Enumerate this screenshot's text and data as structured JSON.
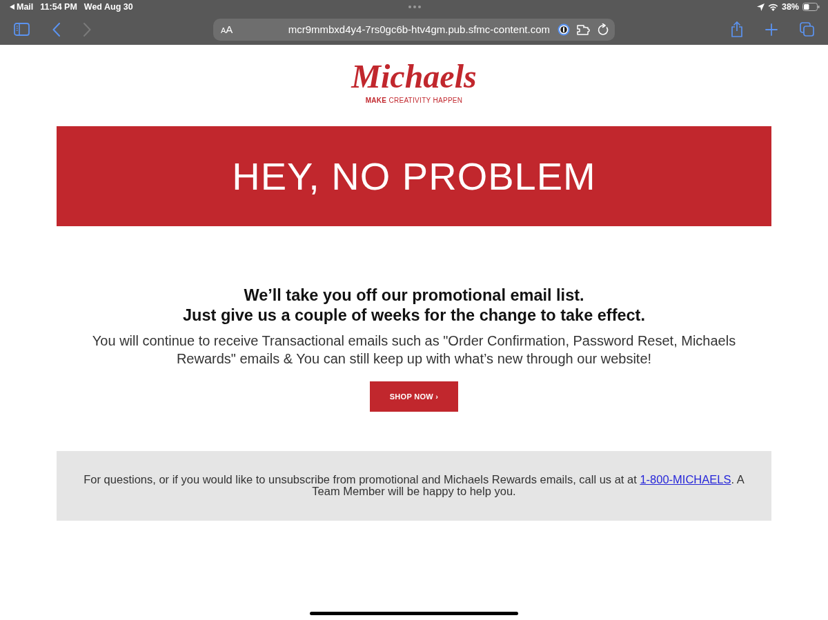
{
  "status_bar": {
    "back_app": "Mail",
    "time": "11:54 PM",
    "date": "Wed Aug 30",
    "battery": "38%"
  },
  "toolbar": {
    "nav": [
      {
        "kind": "back",
        "disabled": false
      },
      {
        "kind": "forward",
        "disabled": true
      }
    ],
    "address_bar": {
      "text_size": "AA",
      "url": "mcr9mmbxd4y4-7rs0gc6b-htv4gm.pub.sfmc-content.com"
    }
  },
  "logo": {
    "wordmark": "Michaels",
    "tagline": "**MAKE** CREATIVITY HAPPEN"
  },
  "banner": {
    "title": "HEY, NO PROBLEM"
  },
  "message": {
    "headline": [
      "We’ll take you off our promotional email list.",
      "Just give us a couple of weeks for the change to take effect."
    ],
    "body": "You will continue to receive Transactional emails such as \"Order Confirmation, Password Reset, Michaels Rewards\" emails & You can still keep up with what’s new through our website!",
    "button": "SHOP NOW ›"
  },
  "footer": {
    "text_before": "For questions, or if you would like to unsubscribe from promotional and Michaels Rewards emails, call us at at ",
    "link": "1-800-MICHAELS",
    "text_after": ". A Team Member will be happy to help you."
  }
}
